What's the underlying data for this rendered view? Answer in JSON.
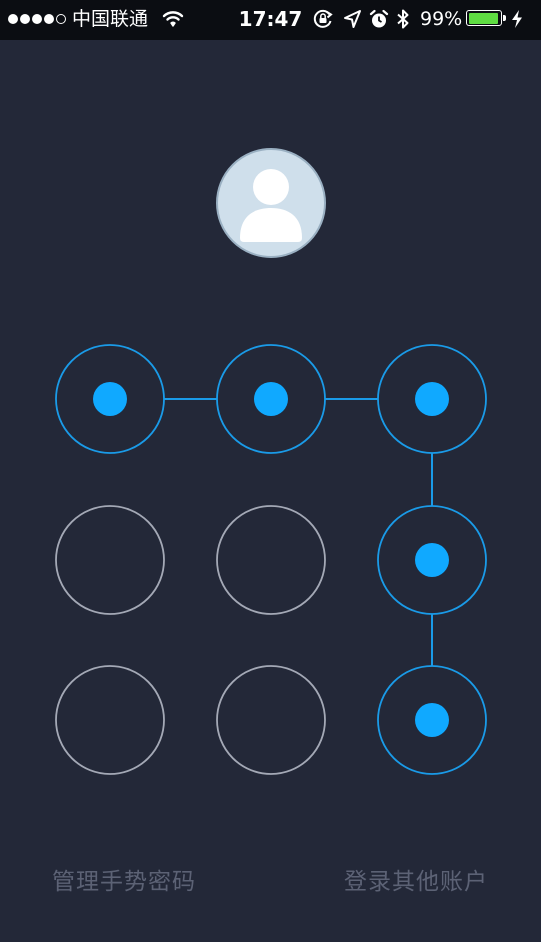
{
  "status_bar": {
    "signal_bars": [
      true,
      true,
      true,
      true,
      false
    ],
    "carrier": "中国联通",
    "time": "17:47",
    "icons": [
      "orientation-lock-icon",
      "location-arrow-icon",
      "alarm-icon",
      "bluetooth-icon"
    ],
    "battery_percent": "99%",
    "battery_level": 0.99,
    "battery_color": "#5fdc42",
    "charging": true
  },
  "profile": {
    "avatar_icon": "user-silhouette-icon"
  },
  "gesture_lock": {
    "rows": 3,
    "cols": 3,
    "selected_nodes": [
      1,
      2,
      3,
      6,
      9
    ],
    "path_sequence": [
      1,
      2,
      3,
      6,
      9
    ],
    "active_color": "#10a9ff",
    "inactive_color": "#a4a9b6"
  },
  "footer": {
    "manage_label": "管理手势密码",
    "switch_account_label": "登录其他账户"
  },
  "colors": {
    "background": "#232838",
    "status_bar": "#0b0d12",
    "footer_text": "#5c6275"
  }
}
